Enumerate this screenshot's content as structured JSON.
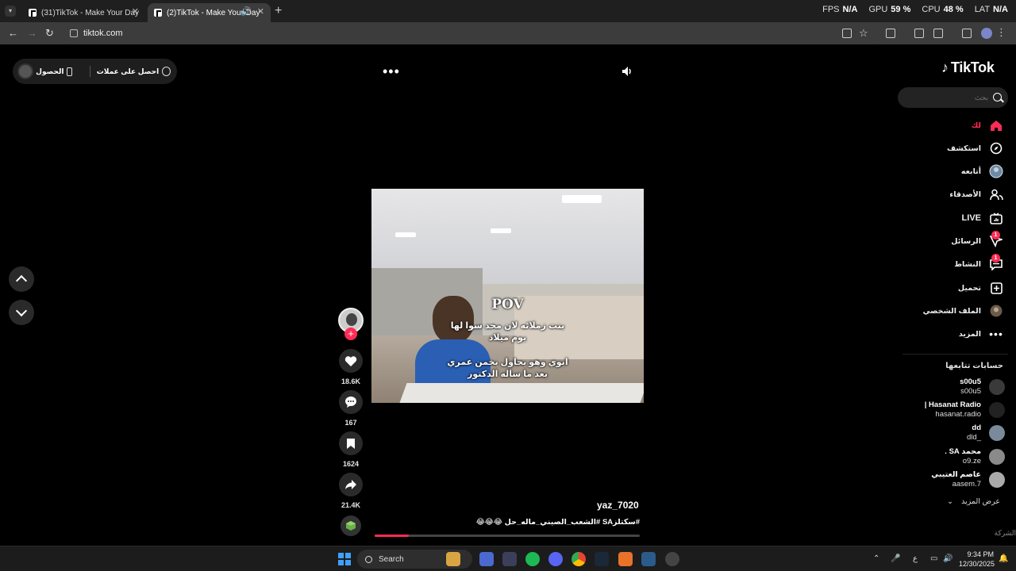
{
  "browser": {
    "tabs": [
      {
        "title": "(31)TikTok - Make Your Day",
        "active": false
      },
      {
        "title": "(2)TikTok - Make Your Day",
        "active": true
      }
    ],
    "url": "tiktok.com",
    "perf": [
      {
        "label": "FPS",
        "value": "N/A"
      },
      {
        "label": "GPU",
        "value": "59 %"
      },
      {
        "label": "CPU",
        "value": "48 %"
      },
      {
        "label": "LAT",
        "value": "N/A"
      }
    ]
  },
  "promo": {
    "coins_text": "احصل على عملات",
    "app_text": "الحصول على التط"
  },
  "video": {
    "caption_pov": "POV",
    "caption_line1": "بنت زملائه لان محد سوا لها يوم ميلاد",
    "caption_line2": "ابوي وهو يحاول يخمن عمري بعد ما ساله الدكتور",
    "author": "yaz_7020",
    "description": "#سكتلزSA #الشعب_الصيني_ماله_حل 😂😂😂",
    "progress": 0.13
  },
  "actions": {
    "likes": "18.6K",
    "comments": "167",
    "saves": "1624",
    "shares": "21.4K"
  },
  "sidebar": {
    "logo": "TikTok",
    "search_placeholder": "بحث",
    "items": [
      {
        "label": "لك",
        "icon": "home-icon",
        "active": true
      },
      {
        "label": "استكشف",
        "icon": "compass-icon"
      },
      {
        "label": "أتابعه",
        "icon": "following-avatar-icon"
      },
      {
        "label": "الأصدقاء",
        "icon": "friends-icon"
      },
      {
        "label": "LIVE",
        "icon": "live-icon"
      },
      {
        "label": "الرسائل",
        "icon": "messages-icon",
        "badge": "1"
      },
      {
        "label": "النشاط",
        "icon": "activity-icon",
        "badge": "1"
      },
      {
        "label": "تحميل",
        "icon": "upload-icon"
      },
      {
        "label": "الملف الشخصي",
        "icon": "profile-icon"
      },
      {
        "label": "المزيد",
        "icon": "more-icon"
      }
    ],
    "following_title": "حسابات تتابعها",
    "accounts": [
      {
        "name": "s00u5",
        "handle": "s00u5"
      },
      {
        "name": "Hasanat Radio |",
        "handle": "hasanat.radio"
      },
      {
        "name": "dd",
        "handle": "_dld"
      },
      {
        "name": "محمد SA .",
        "handle": "o9.ze"
      },
      {
        "name": "عاصم العتيبي",
        "handle": "aasem.7"
      }
    ],
    "see_more": "عرض المزيد",
    "company": "الشركة"
  },
  "taskbar": {
    "search_label": "Search",
    "time": "9:34 PM",
    "date": "12/30/2025",
    "lang": "ع"
  },
  "colors": {
    "accent": "#fe2c55",
    "chrome_bg": "#1f1f1f",
    "toolbar_bg": "#3c3c3c"
  }
}
